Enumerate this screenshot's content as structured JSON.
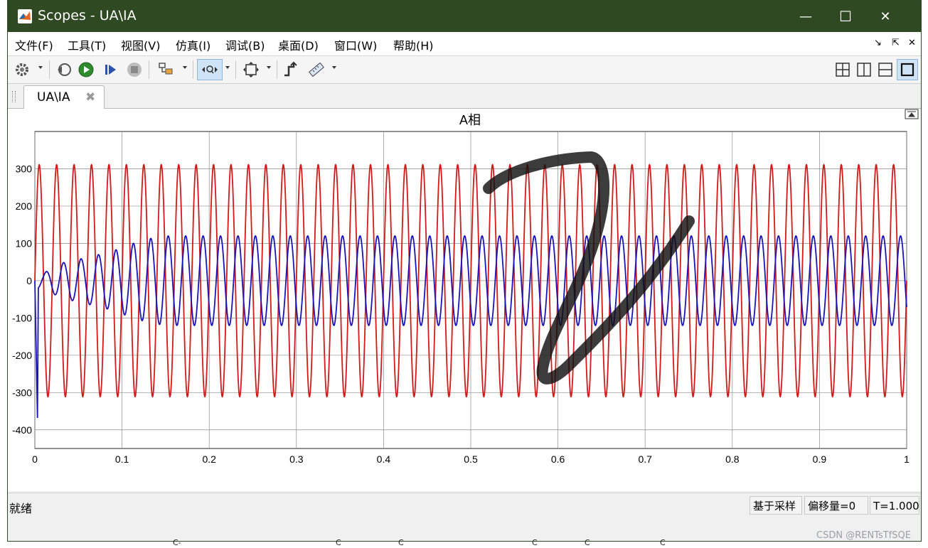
{
  "window": {
    "title": "Scopes - UA\\IA",
    "controls": {
      "minimize": "—",
      "maximize": "☐",
      "close": "✕"
    }
  },
  "menu": [
    "文件(F)",
    "工具(T)",
    "视图(V)",
    "仿真(I)",
    "调试(B)",
    "桌面(D)",
    "窗口(W)",
    "帮助(H)"
  ],
  "menu_right": {
    "undock": "↘",
    "pin": "⇱",
    "close": "✕"
  },
  "tab": {
    "label": "UA\\IA",
    "close": "✖"
  },
  "status": {
    "text": "就绪",
    "mode": "基于采样",
    "offset": "偏移量=0",
    "time": "T=1.000"
  },
  "watermark": "CSDN @RENTsTfSQE",
  "bottom_labels": [
    "C-",
    "C",
    "C",
    "C",
    "C",
    "C"
  ],
  "colors": {
    "titlebar": "#2f4a23",
    "voltage": "#d31a1a",
    "current": "#1a14b8",
    "annotation": "#111111"
  },
  "chart_data": {
    "type": "line",
    "title": "A相",
    "xlabel": "",
    "ylabel": "",
    "xlim": [
      0,
      1
    ],
    "ylim": [
      -450,
      400
    ],
    "x_ticks": [
      "0",
      "0.1",
      "0.2",
      "0.3",
      "0.4",
      "0.5",
      "0.6",
      "0.7",
      "0.8",
      "0.9",
      "1"
    ],
    "y_ticks": [
      "300",
      "200",
      "100",
      "0",
      "-100",
      "-200",
      "-300",
      "-400"
    ],
    "grid": true,
    "series": [
      {
        "color": "#d31a1a",
        "shape": "sine",
        "amplitude": 311,
        "frequency_hz": 50,
        "x": [
          0,
          0.005,
          0.01,
          0.015,
          0.02
        ],
        "y": [
          0,
          311,
          0,
          -311,
          0
        ]
      },
      {
        "color": "#1a14b8",
        "shape": "sine with startup transient",
        "amplitude_envelope": {
          "x": [
            0,
            0.01,
            0.03,
            0.05,
            0.07,
            0.09,
            0.11,
            0.13,
            0.15,
            1.0
          ],
          "y": [
            20,
            20,
            47,
            57,
            68,
            80,
            98,
            112,
            120,
            120
          ]
        },
        "frequency_hz": 50,
        "initial_spike": {
          "x": 0.003,
          "y": -368
        },
        "x": [
          0.003,
          0.008,
          0.013,
          0.018,
          0.15,
          0.155,
          0.16
        ],
        "y": [
          -368,
          20,
          -50,
          47,
          120,
          0,
          -120
        ]
      }
    ]
  }
}
